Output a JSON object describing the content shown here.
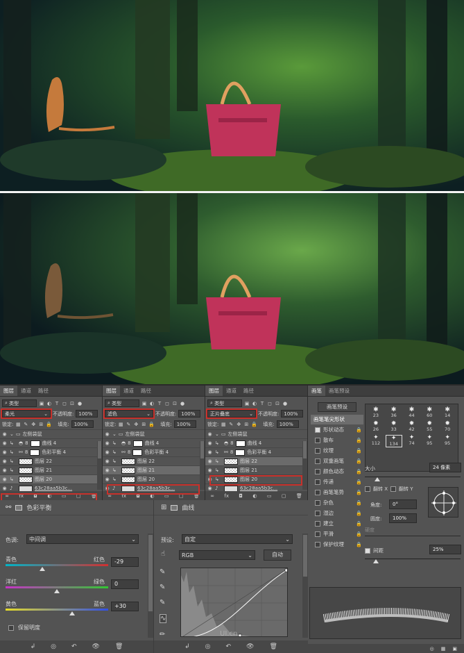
{
  "panels": [
    {
      "tabs": [
        "图层",
        "通道",
        "路径"
      ],
      "filter_label": "类型",
      "blend_mode": "柔光",
      "opacity_label": "不透明度:",
      "opacity_value": "100%",
      "lock_label": "锁定:",
      "fill_label": "填充:",
      "fill_value": "100%",
      "group_name": "左侧袋鼠",
      "layers": [
        "曲线 4",
        "色彩平衡 4",
        "图层 22",
        "图层 21",
        "图层 20"
      ],
      "highlight_index": 4,
      "bottom_layer": "63c28aa5b3c..."
    },
    {
      "tabs": [
        "图层",
        "通道",
        "路径"
      ],
      "filter_label": "类型",
      "blend_mode": "滤色",
      "opacity_label": "不透明度:",
      "opacity_value": "100%",
      "lock_label": "锁定:",
      "fill_label": "填充:",
      "fill_value": "100%",
      "group_name": "左侧袋鼠",
      "layers": [
        "曲线 4",
        "色彩平衡 4",
        "图层 22",
        "图层 21",
        "图层 20"
      ],
      "highlight_index": 3,
      "bottom_layer": "63c28aa5b3c..."
    },
    {
      "tabs": [
        "图层",
        "通道",
        "路径"
      ],
      "filter_label": "类型",
      "blend_mode": "正片叠底",
      "opacity_label": "不透明度:",
      "opacity_value": "100%",
      "lock_label": "锁定:",
      "fill_label": "填充:",
      "fill_value": "100%",
      "group_name": "左侧袋鼠",
      "layers": [
        "曲线 4",
        "色彩平衡 4",
        "图层 22",
        "图层 21",
        "图层 20"
      ],
      "highlight_index": 2,
      "bottom_layer": "63c28aa5b3c..."
    }
  ],
  "brush": {
    "tabs": [
      "画笔",
      "画笔预设"
    ],
    "preset_button": "画笔预设",
    "tip_shape": "画笔笔尖形状",
    "options": [
      {
        "label": "形状动态",
        "on": true
      },
      {
        "label": "散布",
        "on": false
      },
      {
        "label": "纹理",
        "on": false
      },
      {
        "label": "双重画笔",
        "on": false
      },
      {
        "label": "颜色动态",
        "on": false
      },
      {
        "label": "传递",
        "on": false
      },
      {
        "label": "画笔笔势",
        "on": false
      },
      {
        "label": "杂色",
        "on": false
      },
      {
        "label": "湿边",
        "on": false
      },
      {
        "label": "建立",
        "on": false
      },
      {
        "label": "平滑",
        "on": false
      },
      {
        "label": "保护纹理",
        "on": false
      }
    ],
    "sizes": [
      "23",
      "36",
      "44",
      "60",
      "14",
      "26",
      "33",
      "42",
      "55",
      "70",
      "112",
      "134",
      "74",
      "95",
      "95"
    ],
    "size_label": "大小",
    "size_value": "24 像素",
    "flip_x": "翻转 X",
    "flip_y": "翻转 Y",
    "angle_label": "角度:",
    "angle_value": "0°",
    "roundness_label": "圆度:",
    "roundness_value": "100%",
    "hardness_label": "硬度",
    "spacing_label": "间距",
    "spacing_value": "25%"
  },
  "color_balance": {
    "title": "色彩平衡",
    "tone_label": "色调:",
    "tone_value": "中间调",
    "rows": [
      {
        "left": "青色",
        "right": "红色",
        "value": "-29",
        "pos": 0.355,
        "grad": "linear-gradient(90deg,#00b4c8,#d23030)"
      },
      {
        "left": "洋红",
        "right": "绿色",
        "value": "0",
        "pos": 0.5,
        "grad": "linear-gradient(90deg,#c832c8,#32c832)"
      },
      {
        "left": "黄色",
        "right": "蓝色",
        "value": "+30",
        "pos": 0.65,
        "grad": "linear-gradient(90deg,#e6dc28,#3250e6)"
      }
    ],
    "preserve_label": "保留明度"
  },
  "curves": {
    "title": "曲线",
    "preset_label": "预设:",
    "preset_value": "自定",
    "channel": "RGB",
    "auto_button": "自动"
  },
  "watermark": "UI.cn"
}
